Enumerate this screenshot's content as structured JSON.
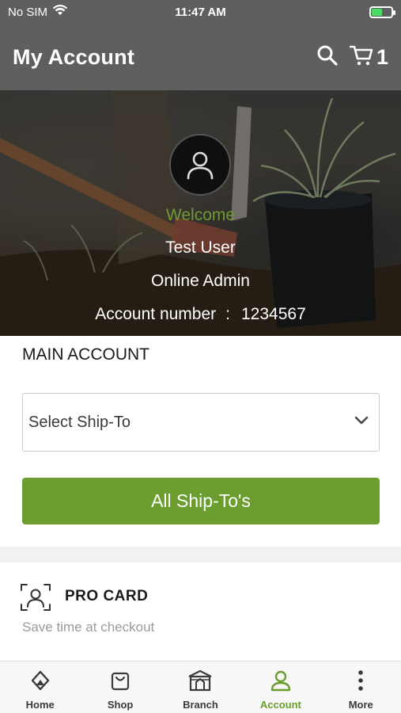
{
  "status_bar": {
    "carrier": "No SIM",
    "time": "11:47 AM",
    "battery_level": 0.55
  },
  "header": {
    "title": "My Account",
    "search_icon": "search-icon",
    "cart_icon": "cart-icon",
    "cart_count": "1"
  },
  "hero": {
    "welcome": "Welcome",
    "username": "Test User",
    "role": "Online Admin",
    "account_label": "Account number",
    "account_separator": ":",
    "account_number": "1234567"
  },
  "main_account": {
    "title": "MAIN ACCOUNT",
    "select_value": "Select Ship-To",
    "all_button_label": "All Ship-To's"
  },
  "pro_card": {
    "title": "PRO CARD",
    "subtitle": "Save time at checkout"
  },
  "bottom_nav": {
    "items": [
      {
        "label": "Home",
        "icon": "home-icon"
      },
      {
        "label": "Shop",
        "icon": "shopping-bag-icon"
      },
      {
        "label": "Branch",
        "icon": "branch-store-icon"
      },
      {
        "label": "Account",
        "icon": "account-user-icon",
        "active": true
      },
      {
        "label": "More",
        "icon": "more-dots-icon"
      }
    ]
  },
  "colors": {
    "header_bg": "#5e5f60",
    "accent_green": "#6c9d2f",
    "welcome_green": "#6f9a34"
  }
}
